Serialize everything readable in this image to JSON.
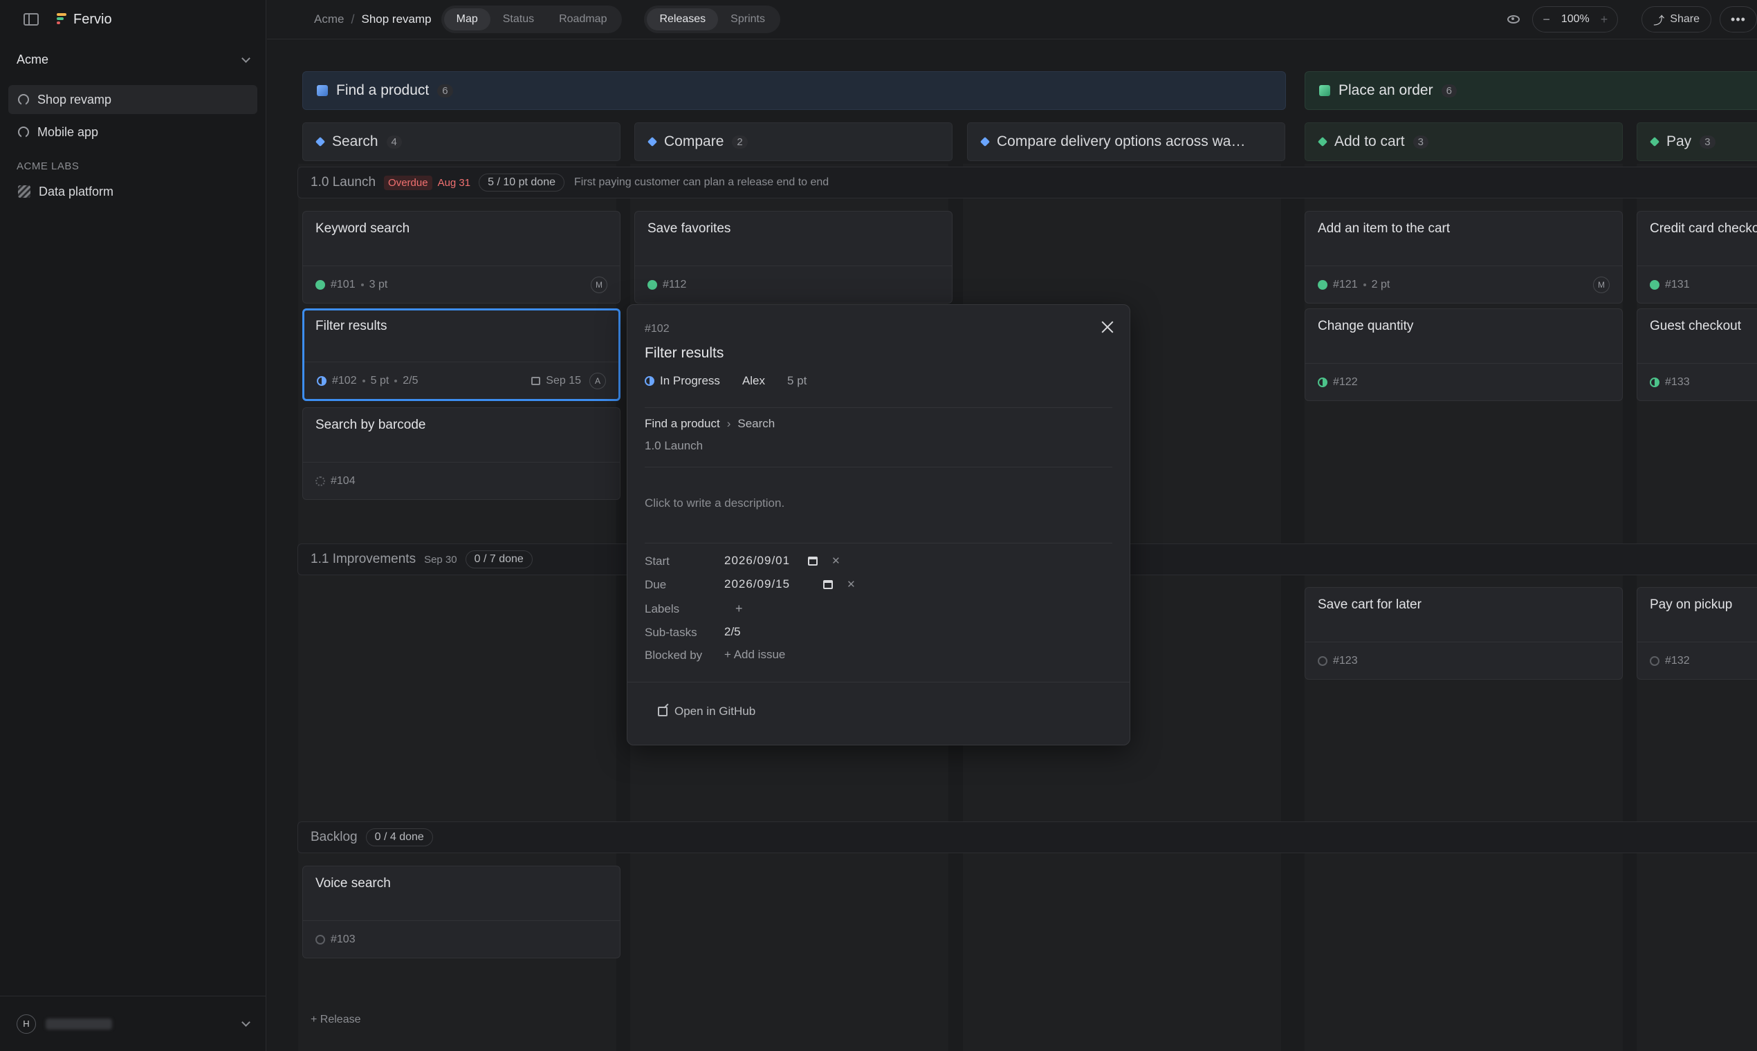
{
  "app": {
    "name": "Fervio"
  },
  "sidebar": {
    "org": "Acme",
    "projects": [
      {
        "label": "Shop revamp",
        "active": true
      },
      {
        "label": "Mobile app",
        "active": false
      }
    ],
    "section_label": "ACME LABS",
    "section_items": [
      {
        "label": "Data platform"
      }
    ],
    "user_initial": "H"
  },
  "topbar": {
    "breadcrumb": [
      "Acme",
      "Shop revamp"
    ],
    "view_tabs": [
      "Map",
      "Status",
      "Roadmap"
    ],
    "active_view": "Map",
    "group_tabs": [
      "Releases",
      "Sprints"
    ],
    "active_group": "Releases",
    "zoom": "100%",
    "share_label": "Share"
  },
  "board": {
    "epics": [
      {
        "title": "Find a product",
        "count": "6",
        "color": "#6aa5ff"
      },
      {
        "title": "Place an order",
        "count": "6",
        "color": "#4cc38a"
      }
    ],
    "features": [
      {
        "title": "Search",
        "count": "4"
      },
      {
        "title": "Compare",
        "count": "2"
      },
      {
        "title": "Compare delivery options across wa…",
        "count": ""
      },
      {
        "title": "Add to cart",
        "count": "3"
      },
      {
        "title": "Pay",
        "count": "3"
      }
    ],
    "releases": [
      {
        "name": "1.0 Launch",
        "badge": "Overdue",
        "date": "Aug 31",
        "progress": "5 / 10 pt done",
        "description": "First paying customer can plan a release end to end"
      },
      {
        "name": "1.1 Improvements",
        "date": "Sep 30",
        "progress": "0 / 7 done"
      },
      {
        "name": "Backlog",
        "progress": "0 / 4 done"
      }
    ],
    "cards": {
      "c101": {
        "title": "Keyword search",
        "id": "#101",
        "points": "3 pt",
        "assignee": "M"
      },
      "c112": {
        "title": "Save favorites",
        "id": "#112"
      },
      "c121": {
        "title": "Add an item to the cart",
        "id": "#121",
        "points": "2 pt",
        "assignee": "M"
      },
      "c131": {
        "title": "Credit card checkout",
        "id": "#131"
      },
      "c102": {
        "title": "Filter results",
        "id": "#102",
        "points": "5 pt",
        "subtasks": "2/5",
        "due": "Sep 15",
        "assignee": "A"
      },
      "c122": {
        "title": "Change quantity",
        "id": "#122"
      },
      "c133": {
        "title": "Guest checkout",
        "id": "#133"
      },
      "c104": {
        "title": "Search by barcode",
        "id": "#104"
      },
      "c123": {
        "title": "Save cart for later",
        "id": "#123"
      },
      "c132": {
        "title": "Pay on pickup",
        "id": "#132"
      },
      "c103": {
        "title": "Voice search",
        "id": "#103"
      }
    },
    "add_release": "+ Release"
  },
  "popover": {
    "id": "#102",
    "title": "Filter results",
    "status": "In Progress",
    "assignee": "Alex",
    "points": "5 pt",
    "epic": "Find a product",
    "feature": "Search",
    "release": "1.0 Launch",
    "description_placeholder": "Click to write a description.",
    "fields": {
      "start_label": "Start",
      "start_value": "2026/09/01",
      "due_label": "Due",
      "due_value": "2026/09/15",
      "labels_label": "Labels",
      "labels_add": "+",
      "subtasks_label": "Sub-tasks",
      "subtasks_value": "2/5",
      "blocked_label": "Blocked by",
      "blocked_add": "+ Add issue"
    },
    "github_link": "Open in GitHub"
  }
}
